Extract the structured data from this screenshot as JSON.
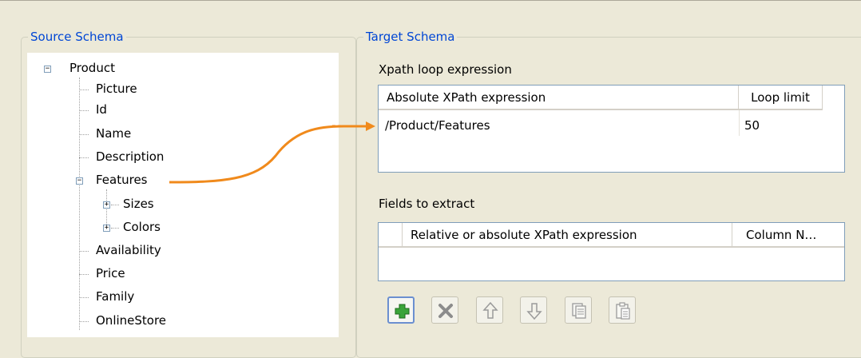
{
  "source_schema": {
    "title": "Source Schema",
    "tree": {
      "root": "Product",
      "items": [
        "Picture",
        "Id",
        "Name",
        "Description",
        "Features",
        "Sizes",
        "Colors",
        "Availability",
        "Price",
        "Family",
        "OnlineStore"
      ]
    }
  },
  "target_schema": {
    "title": "Target Schema",
    "loop_section_label": "Xpath loop expression",
    "loop_table": {
      "headers": [
        "Absolute XPath expression",
        "Loop limit"
      ],
      "row": {
        "expression": "/Product/Features",
        "limit": "50"
      }
    },
    "fields_section_label": "Fields to extract",
    "fields_table": {
      "headers": [
        "Relative or absolute XPath expression",
        "Column N…"
      ]
    },
    "toolbar": {
      "buttons": [
        "add-icon",
        "delete-icon",
        "move-up-icon",
        "move-down-icon",
        "copy-icon",
        "paste-icon"
      ]
    }
  },
  "colors": {
    "accent": "#0046d5",
    "arrow": "#f08a1c",
    "add": "#3aa43a"
  }
}
